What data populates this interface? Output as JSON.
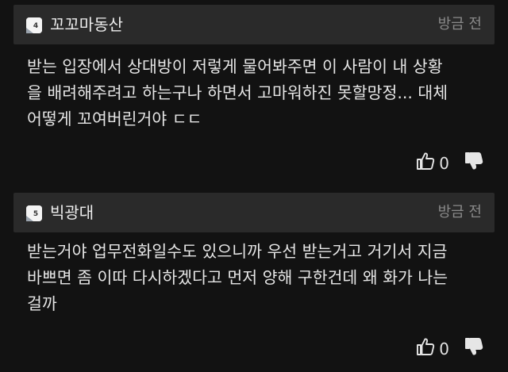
{
  "comments": [
    {
      "level": "4",
      "author": "꼬꼬마동산",
      "time": "방금 전",
      "lines": [
        "받는 입장에서 상대방이 저렇게 물어봐주면 이 사람이 내 상황",
        "을 배려해주려고 하는구나 하면서 고마워하진 못할망정... 대체",
        "어떻게 꼬여버린거야 ㄷㄷ"
      ],
      "likes": "0"
    },
    {
      "level": "5",
      "author": "빅광대",
      "time": "방금 전",
      "lines": [
        "받는거야 업무전화일수도 있으니까 우선 받는거고 거기서 지금",
        "바쁘면 좀 이따 다시하겠다고 먼저 양해 구한건데 왜 화가 나는",
        "걸까"
      ],
      "likes": "0"
    }
  ]
}
